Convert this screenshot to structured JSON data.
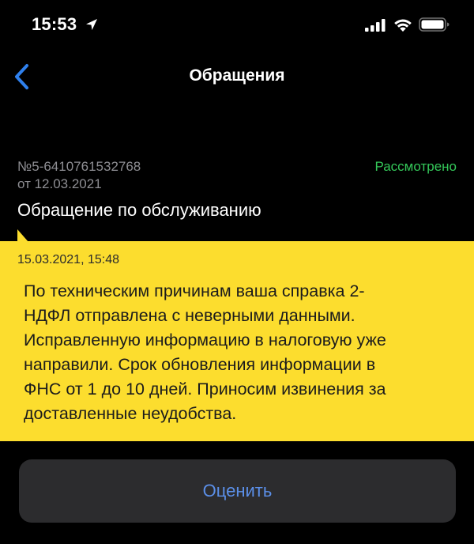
{
  "status_bar": {
    "time": "15:53",
    "icons": [
      "location-arrow-icon",
      "signal-icon",
      "wifi-icon",
      "battery-icon"
    ]
  },
  "nav": {
    "back_icon": "chevron-left-icon",
    "title": "Обращения"
  },
  "ticket": {
    "number": "№5-6410761532768",
    "date": "от 12.03.2021",
    "status": "Рассмотрено",
    "subject": "Обращение по обслуживанию"
  },
  "message": {
    "timestamp": "15.03.2021, 15:48",
    "lines": [
      "По техническим причинам ваша справка 2-",
      "НДФЛ отправлена с неверными данными.",
      "Исправленную информацию в налоговую уже",
      "направили. Срок обновления информации в",
      "ФНС от 1 до 10 дней. Приносим извинения за",
      "доставленные неудобства."
    ]
  },
  "actions": {
    "rate_label": "Оценить"
  },
  "colors": {
    "background": "#000000",
    "accent_blue": "#2f80ed",
    "status_green": "#34c759",
    "bubble_yellow": "#fcdd2e",
    "button_bg": "#2c2c2e",
    "secondary_text": "#8e8e93"
  }
}
